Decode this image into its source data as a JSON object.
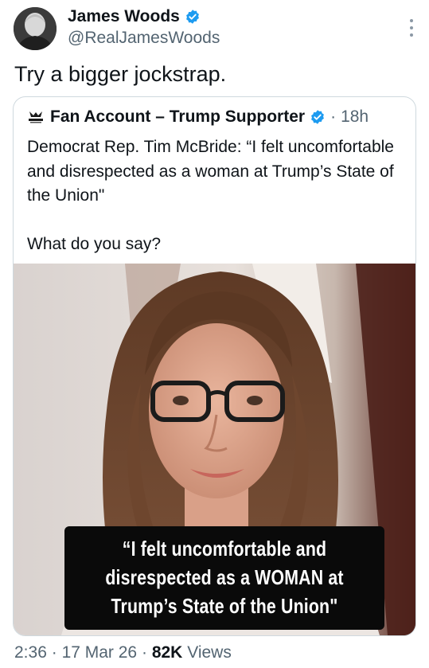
{
  "tweet": {
    "author_name": "James Woods",
    "handle": "@RealJamesWoods",
    "text": "Try a bigger jockstrap.",
    "time": "2:36",
    "date": "17 Mar 26",
    "views_count": "82K",
    "views_label": "Views",
    "dot": "·"
  },
  "quote": {
    "account_name": "Fan Account – Trump Supporter",
    "separator": "·",
    "time": "18h",
    "text_line1": "Democrat Rep. Tim McBride: “I felt uncomfortable and disrespected as a woman at Trump’s State of the Union\"",
    "text_line2": "What do you say?",
    "image_caption": "“I felt uncomfortable and disrespected as a WOMAN at Trump’s State of the Union\""
  },
  "colors": {
    "text_primary": "#0f1419",
    "text_secondary": "#536471",
    "verified_blue": "#1d9bf0",
    "border": "#cfd9de"
  },
  "icons": {
    "verified": "verified-badge-icon",
    "more": "more-options-icon"
  }
}
